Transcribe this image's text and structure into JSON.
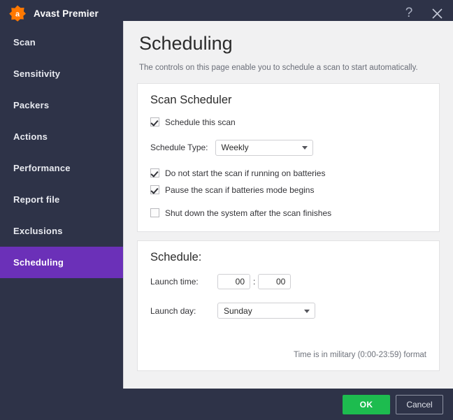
{
  "window": {
    "app_title": "Avast Premier",
    "logo_icon": "avast-logo-icon",
    "help_icon": "?",
    "close_icon": "close-icon",
    "accent_purple": "#6b30b8",
    "accent_orange": "#ff7800",
    "accent_green": "#1dbc4f",
    "chrome_bg": "#2e3348"
  },
  "sidebar": {
    "items": [
      {
        "label": "Scan",
        "active": false
      },
      {
        "label": "Sensitivity",
        "active": false
      },
      {
        "label": "Packers",
        "active": false
      },
      {
        "label": "Actions",
        "active": false
      },
      {
        "label": "Performance",
        "active": false
      },
      {
        "label": "Report file",
        "active": false
      },
      {
        "label": "Exclusions",
        "active": false
      },
      {
        "label": "Scheduling",
        "active": true
      }
    ]
  },
  "page": {
    "title": "Scheduling",
    "description": "The controls on this page enable you to schedule a scan to start automatically."
  },
  "scan_scheduler": {
    "title": "Scan Scheduler",
    "schedule_this_scan": {
      "label": "Schedule this scan",
      "checked": true
    },
    "schedule_type": {
      "label": "Schedule Type:",
      "value": "Weekly"
    },
    "no_batteries": {
      "label": "Do not start the scan if running on batteries",
      "checked": true
    },
    "pause_batteries": {
      "label": "Pause the scan if batteries mode begins",
      "checked": true
    },
    "shutdown": {
      "label": "Shut down the system after the scan finishes",
      "checked": false
    }
  },
  "schedule": {
    "title": "Schedule:",
    "launch_time": {
      "label": "Launch time:",
      "hours": "00",
      "minutes": "00",
      "separator": ":"
    },
    "launch_day": {
      "label": "Launch day:",
      "value": "Sunday"
    },
    "hint": "Time is in military (0:00-23:59) format"
  },
  "footer": {
    "ok_label": "OK",
    "cancel_label": "Cancel"
  }
}
